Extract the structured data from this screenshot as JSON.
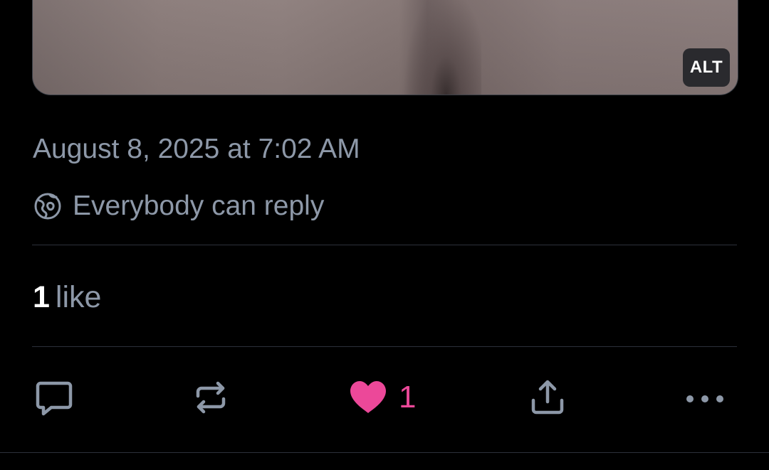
{
  "post": {
    "media": {
      "alt_label": "ALT"
    },
    "timestamp": "August 8, 2025 at 7:02 AM",
    "reply_setting": {
      "icon": "globe-icon",
      "label": "Everybody can reply"
    },
    "likes": {
      "count": "1",
      "label": "like"
    },
    "actions": {
      "reply": {
        "icon": "reply-bubble-icon"
      },
      "repost": {
        "icon": "repost-icon"
      },
      "like": {
        "icon": "heart-filled-icon",
        "count": "1",
        "color": "#ec4899"
      },
      "share": {
        "icon": "share-icon"
      },
      "more": {
        "icon": "more-horizontal-icon"
      }
    }
  },
  "colors": {
    "background": "#000000",
    "secondary_text": "#8d98a8",
    "primary_text": "#ffffff",
    "divider": "#2c313a",
    "like_accent": "#ec4899",
    "icon": "#8d98a8"
  }
}
